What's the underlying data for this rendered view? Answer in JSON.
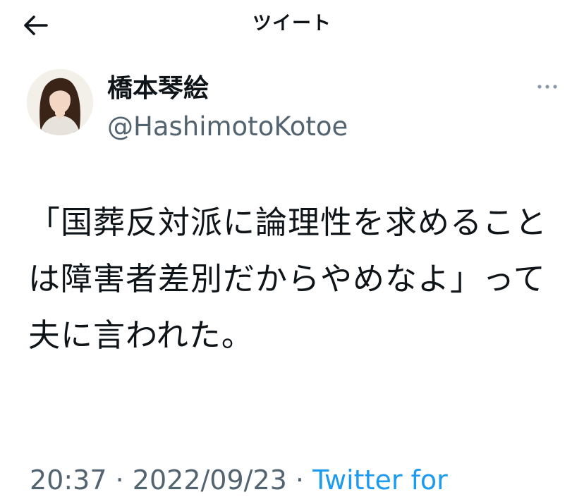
{
  "header": {
    "title": "ツイート",
    "back_icon": "arrow-left-icon"
  },
  "author": {
    "display_name": "橋本琴絵",
    "handle": "@HashimotoKotoe",
    "more_icon": "more-horizontal-icon"
  },
  "tweet": {
    "text": "「国葬反対派に論理性を求めることは障害者差別だからやめなよ」って夫に言われた。"
  },
  "meta": {
    "time": "20:37",
    "separator": "·",
    "date": "2022/09/23",
    "source": "Twitter for"
  },
  "colors": {
    "text": "#0f1419",
    "secondary": "#536471",
    "link": "#1d9bf0",
    "background": "#ffffff"
  }
}
